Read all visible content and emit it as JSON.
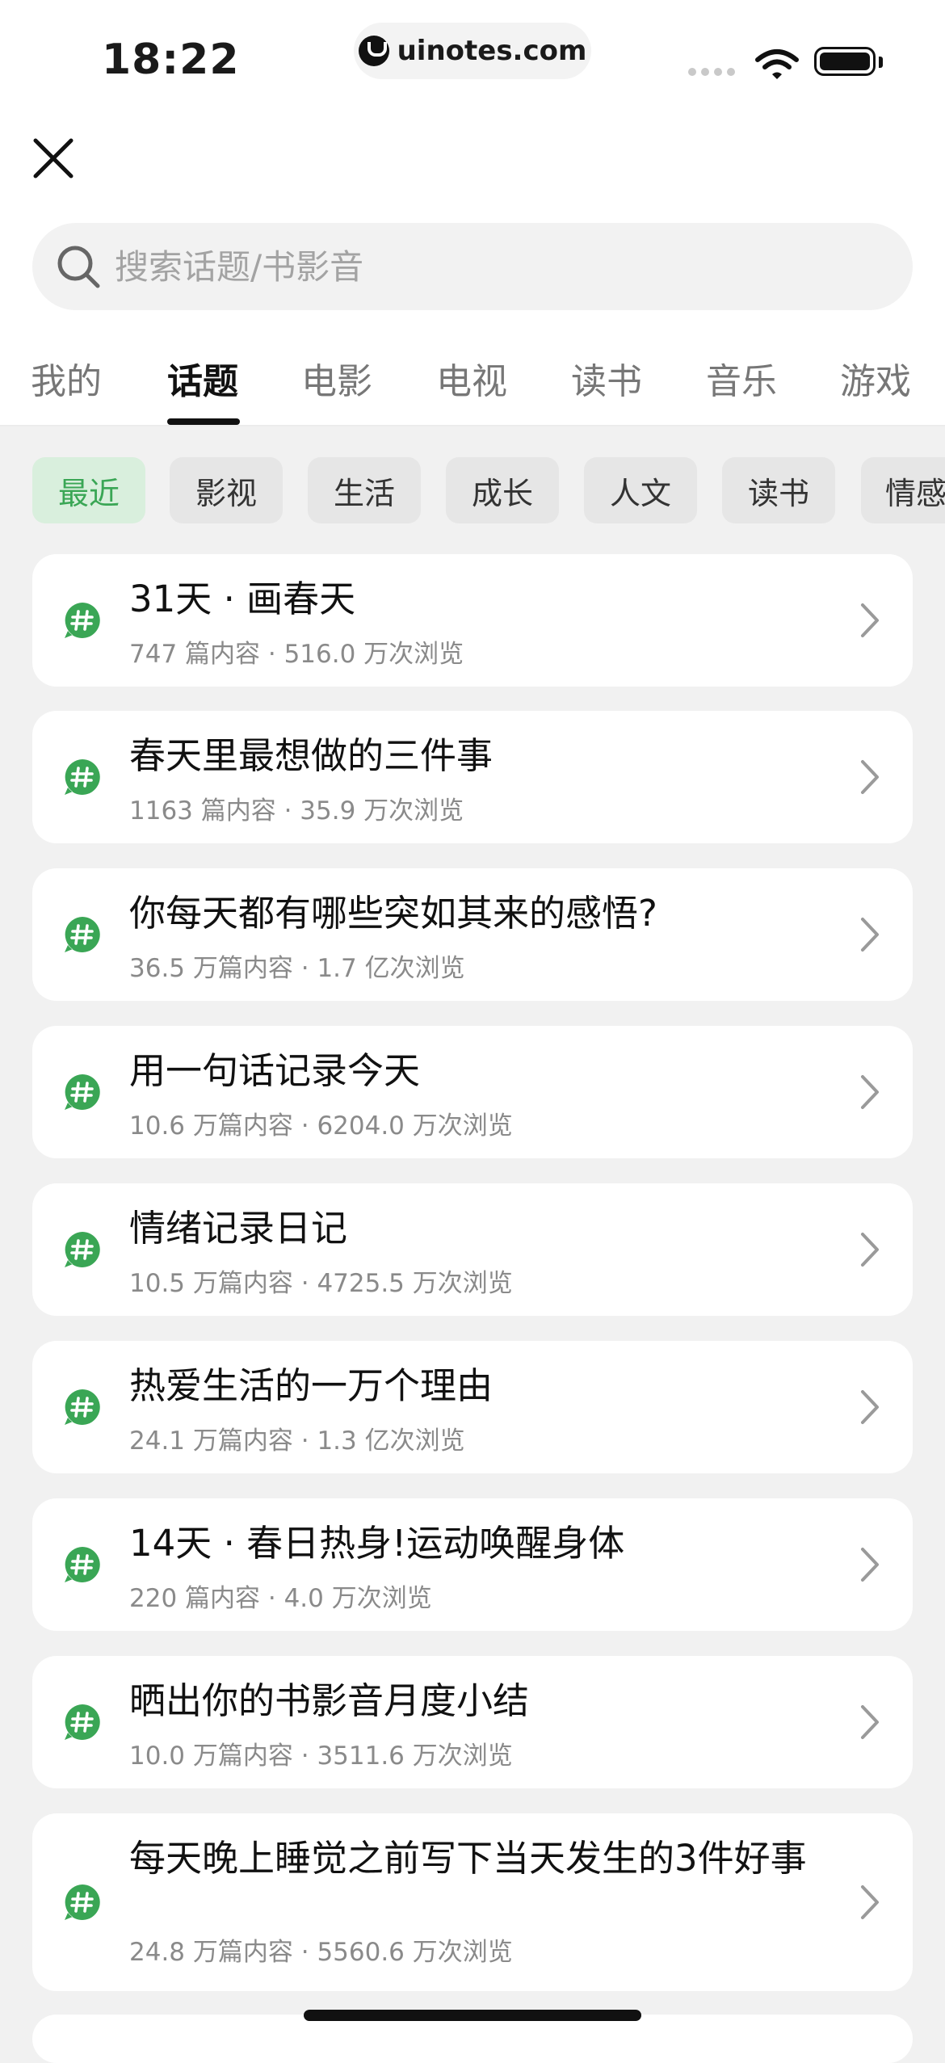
{
  "status_bar": {
    "time": "18:22",
    "url": "uinotes.com"
  },
  "search": {
    "placeholder": "搜索话题/书影音"
  },
  "tabs": [
    "我的",
    "话题",
    "电影",
    "电视",
    "读书",
    "音乐",
    "游戏"
  ],
  "active_tab": "话题",
  "chips": [
    "最近",
    "影视",
    "生活",
    "成长",
    "人文",
    "读书",
    "情感"
  ],
  "active_chip": "最近",
  "accent_color": "#3aa655",
  "topics": [
    {
      "title": "31天 · 画春天",
      "meta": "747 篇内容 · 516.0 万次浏览"
    },
    {
      "title": "春天里最想做的三件事",
      "meta": "1163 篇内容 · 35.9 万次浏览"
    },
    {
      "title": "你每天都有哪些突如其来的感悟?",
      "meta": "36.5 万篇内容 · 1.7 亿次浏览"
    },
    {
      "title": "用一句话记录今天",
      "meta": "10.6 万篇内容 · 6204.0 万次浏览"
    },
    {
      "title": "情绪记录日记",
      "meta": "10.5 万篇内容 · 4725.5 万次浏览"
    },
    {
      "title": "热爱生活的一万个理由",
      "meta": "24.1 万篇内容 · 1.3 亿次浏览"
    },
    {
      "title": "14天 · 春日热身!运动唤醒身体",
      "meta": "220 篇内容 · 4.0 万次浏览"
    },
    {
      "title": "晒出你的书影音月度小结",
      "meta": "10.0 万篇内容 · 3511.6 万次浏览"
    },
    {
      "title": "每天晚上睡觉之前写下当天发生的3件好事",
      "meta": "24.8 万篇内容 · 5560.6 万次浏览"
    }
  ]
}
